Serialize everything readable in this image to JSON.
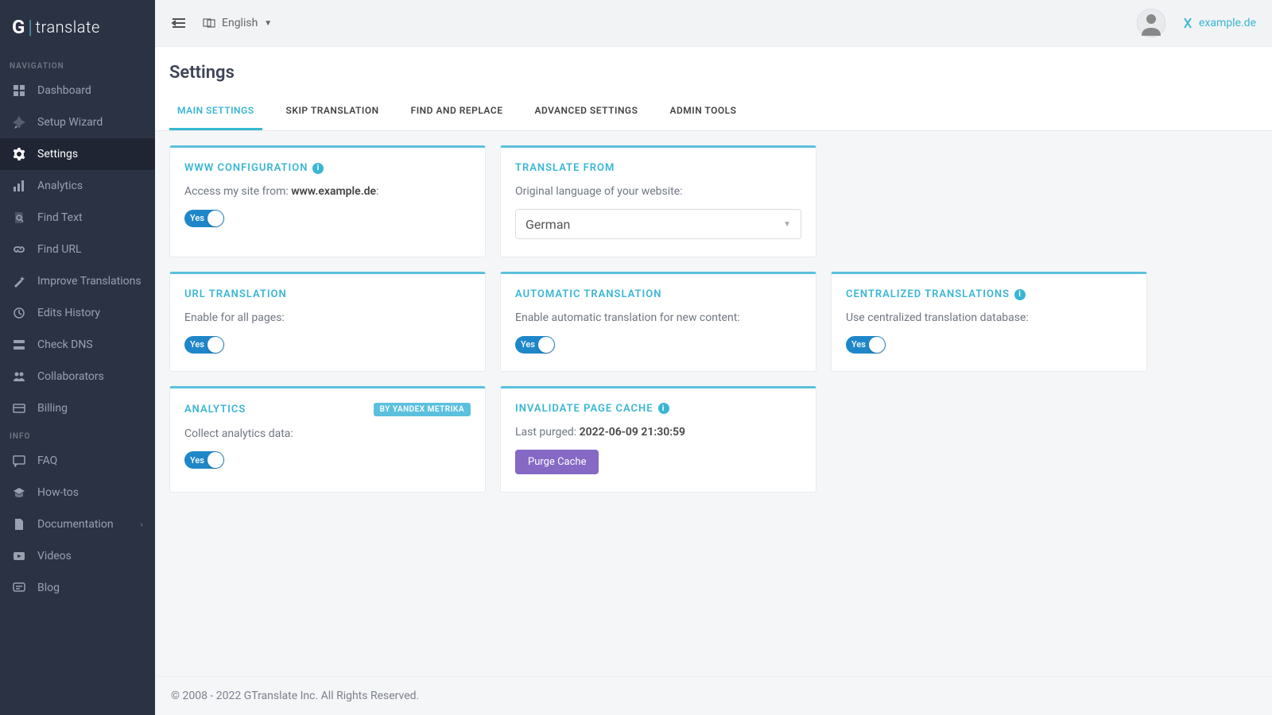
{
  "brand": {
    "g": "G",
    "text": "translate"
  },
  "sidebar": {
    "nav_heading": "NAVIGATION",
    "info_heading": "INFO",
    "items": [
      {
        "id": "dashboard",
        "label": "Dashboard"
      },
      {
        "id": "setup-wizard",
        "label": "Setup Wizard"
      },
      {
        "id": "settings",
        "label": "Settings",
        "active": true
      },
      {
        "id": "analytics",
        "label": "Analytics"
      },
      {
        "id": "find-text",
        "label": "Find Text"
      },
      {
        "id": "find-url",
        "label": "Find URL"
      },
      {
        "id": "improve",
        "label": "Improve Translations"
      },
      {
        "id": "history",
        "label": "Edits History"
      },
      {
        "id": "check-dns",
        "label": "Check DNS"
      },
      {
        "id": "collab",
        "label": "Collaborators"
      },
      {
        "id": "billing",
        "label": "Billing"
      }
    ],
    "info_items": [
      {
        "id": "faq",
        "label": "FAQ"
      },
      {
        "id": "howtos",
        "label": "How-tos"
      },
      {
        "id": "docs",
        "label": "Documentation",
        "chevron": true
      },
      {
        "id": "videos",
        "label": "Videos"
      },
      {
        "id": "blog",
        "label": "Blog"
      }
    ]
  },
  "topbar": {
    "language": "English",
    "site": "example.de"
  },
  "page": {
    "title": "Settings"
  },
  "tabs": [
    {
      "id": "main",
      "label": "MAIN SETTINGS",
      "active": true
    },
    {
      "id": "skip",
      "label": "SKIP TRANSLATION"
    },
    {
      "id": "find",
      "label": "FIND AND REPLACE"
    },
    {
      "id": "advanced",
      "label": "ADVANCED SETTINGS"
    },
    {
      "id": "admin",
      "label": "ADMIN TOOLS"
    }
  ],
  "cards": {
    "www": {
      "title": "WWW CONFIGURATION",
      "desc_prefix": "Access my site from: ",
      "desc_value": "www.example.de",
      "desc_suffix": ":",
      "toggle": "Yes"
    },
    "translate_from": {
      "title": "TRANSLATE FROM",
      "desc": "Original language of your website:",
      "value": "German"
    },
    "url_translation": {
      "title": "URL TRANSLATION",
      "desc": "Enable for all pages:",
      "toggle": "Yes"
    },
    "auto_translation": {
      "title": "AUTOMATIC TRANSLATION",
      "desc": "Enable automatic translation for new content:",
      "toggle": "Yes"
    },
    "centralized": {
      "title": "CENTRALIZED TRANSLATIONS",
      "desc": "Use centralized translation database:",
      "toggle": "Yes"
    },
    "analytics": {
      "title": "ANALYTICS",
      "badge": "BY YANDEX METRIKA",
      "desc": "Collect analytics data:",
      "toggle": "Yes"
    },
    "cache": {
      "title": "INVALIDATE PAGE CACHE",
      "desc_prefix": "Last purged: ",
      "desc_value": "2022-06-09 21:30:59",
      "button": "Purge Cache"
    }
  },
  "footer": "© 2008 - 2022 GTranslate Inc. All Rights Reserved."
}
